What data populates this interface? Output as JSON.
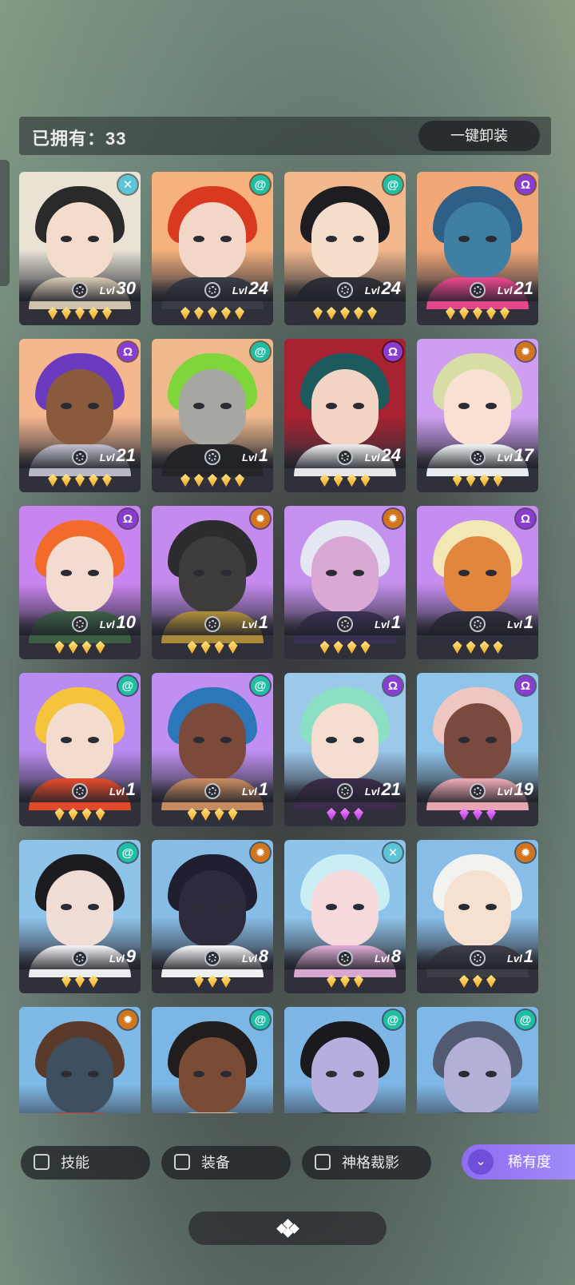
{
  "header": {
    "owned_label": "已拥有：33",
    "unequip_label": "一键卸装"
  },
  "element_colors": {
    "spiral": "#1fbfa3",
    "cross": "#5bc4d6",
    "omega": "#8a3cd3",
    "sun": "#d2751c"
  },
  "cards": [
    {
      "level": "30",
      "stars": 5,
      "star_color": "gold",
      "element": "cross",
      "palette": [
        "#e9e3d6",
        "#2a2a2a",
        "#f4dccd",
        "#cfc3ad"
      ]
    },
    {
      "level": "24",
      "stars": 5,
      "star_color": "gold",
      "element": "spiral",
      "palette": [
        "#f6b17c",
        "#d8391f",
        "#f2d7c9",
        "#3a3c45"
      ]
    },
    {
      "level": "24",
      "stars": 5,
      "star_color": "gold",
      "element": "spiral",
      "palette": [
        "#f3b98c",
        "#1d1d22",
        "#f5ddcc",
        "#2f2f36"
      ]
    },
    {
      "level": "21",
      "stars": 5,
      "star_color": "gold",
      "element": "omega",
      "palette": [
        "#f2a777",
        "#2e5f86",
        "#3f7fa3",
        "#e6468c"
      ]
    },
    {
      "level": "21",
      "stars": 5,
      "star_color": "gold",
      "element": "omega",
      "palette": [
        "#f5b78e",
        "#6b3bbf",
        "#8a5a3d",
        "#b9b9c6"
      ]
    },
    {
      "level": "1",
      "stars": 5,
      "star_color": "gold",
      "element": "spiral",
      "palette": [
        "#f0b98c",
        "#7fd63a",
        "#a6a7a3",
        "#262629"
      ]
    },
    {
      "level": "24",
      "stars": 4,
      "star_color": "gold",
      "element": "omega",
      "palette": [
        "#a82231",
        "#1c5a5d",
        "#f4d5c5",
        "#e7e7ea"
      ]
    },
    {
      "level": "17",
      "stars": 4,
      "star_color": "gold",
      "element": "sun",
      "palette": [
        "#ce9ef0",
        "#d8dca5",
        "#f8e0d2",
        "#e8ecee"
      ]
    },
    {
      "level": "10",
      "stars": 4,
      "star_color": "gold",
      "element": "omega",
      "palette": [
        "#c884ef",
        "#f26b2b",
        "#f3dccf",
        "#3b5e45"
      ]
    },
    {
      "level": "1",
      "stars": 4,
      "star_color": "gold",
      "element": "sun",
      "palette": [
        "#c48aee",
        "#2c2c2e",
        "#3d3c3a",
        "#a88a3a"
      ]
    },
    {
      "level": "1",
      "stars": 4,
      "star_color": "gold",
      "element": "sun",
      "palette": [
        "#c590ee",
        "#e4e6f2",
        "#d9a8d5",
        "#3a3050"
      ]
    },
    {
      "level": "1",
      "stars": 4,
      "star_color": "gold",
      "element": "omega",
      "palette": [
        "#c58df0",
        "#f1e8b5",
        "#e0873d",
        "#2f2e3c"
      ]
    },
    {
      "level": "1",
      "stars": 4,
      "star_color": "gold",
      "element": "spiral",
      "palette": [
        "#b98cf1",
        "#f5c43b",
        "#f3dccd",
        "#e04a2b"
      ]
    },
    {
      "level": "1",
      "stars": 4,
      "star_color": "gold",
      "element": "spiral",
      "palette": [
        "#c08ff1",
        "#2b77b9",
        "#7b4a3a",
        "#c58a5f"
      ]
    },
    {
      "level": "21",
      "stars": 3,
      "star_color": "purple",
      "element": "omega",
      "palette": [
        "#9cc8ea",
        "#8be0c4",
        "#f6ddd2",
        "#3a2c4a"
      ]
    },
    {
      "level": "19",
      "stars": 3,
      "star_color": "purple",
      "element": "omega",
      "palette": [
        "#8fc5ea",
        "#f0c6c0",
        "#7a4a3e",
        "#e8a7b0"
      ]
    },
    {
      "level": "9",
      "stars": 3,
      "star_color": "gold",
      "element": "spiral",
      "palette": [
        "#8ec3ea",
        "#1c1c20",
        "#f0ddd6",
        "#ededf0"
      ]
    },
    {
      "level": "8",
      "stars": 3,
      "star_color": "gold",
      "element": "sun",
      "palette": [
        "#87bce6",
        "#1f1f2f",
        "#2d2a3c",
        "#f0f0f2"
      ]
    },
    {
      "level": "8",
      "stars": 3,
      "star_color": "gold",
      "element": "cross",
      "palette": [
        "#8fc4ea",
        "#c9eef3",
        "#f6d9db",
        "#d8a7cf"
      ]
    },
    {
      "level": "1",
      "stars": 3,
      "star_color": "gold",
      "element": "sun",
      "palette": [
        "#87bde7",
        "#f2f2ef",
        "#f6e0d0",
        "#3c3d45"
      ]
    },
    {
      "level": "",
      "stars": 0,
      "star_color": "gold",
      "element": "sun",
      "palette": [
        "#7fb9e6",
        "#5c3a2a",
        "#3e5060",
        "#c23a3a"
      ]
    },
    {
      "level": "",
      "stars": 0,
      "star_color": "gold",
      "element": "spiral",
      "palette": [
        "#7bb6e4",
        "#221d1d",
        "#7b4c35",
        "#d6c0a0"
      ]
    },
    {
      "level": "",
      "stars": 0,
      "star_color": "gold",
      "element": "spiral",
      "palette": [
        "#7eb7e5",
        "#1a1a1e",
        "#b8aedd",
        "#2a2a33"
      ]
    },
    {
      "level": "",
      "stars": 0,
      "star_color": "gold",
      "element": "spiral",
      "palette": [
        "#7fb7e6",
        "#515a70",
        "#b3b0d8",
        "#4a4f5c"
      ]
    }
  ],
  "level_prefix": "Lvl",
  "filters": [
    {
      "label": "技能"
    },
    {
      "label": "装备"
    },
    {
      "label": "神格裁影"
    }
  ],
  "sort": {
    "label": "稀有度",
    "icon": "double-chevron-down-icon"
  },
  "bottom_button": {
    "icon": "diamond-cluster-icon"
  }
}
